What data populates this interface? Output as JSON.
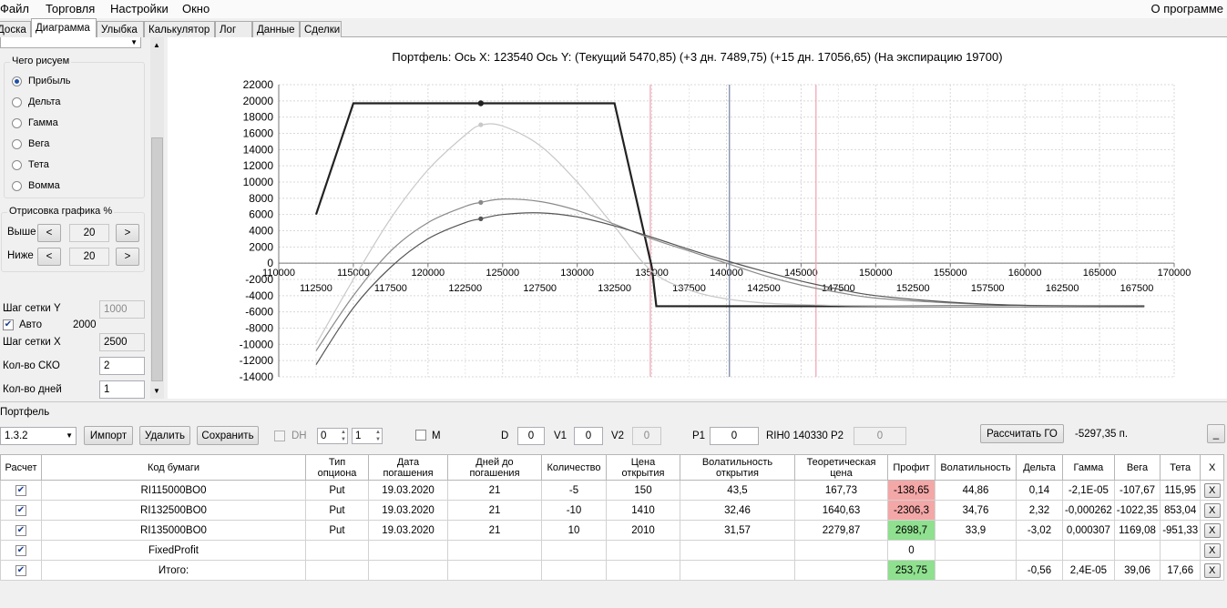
{
  "menu": {
    "file": "Файл",
    "trading": "Торговля",
    "settings": "Настройки",
    "window": "Окно",
    "about": "О программе"
  },
  "tabs": [
    "Доска",
    "Диаграмма",
    "Улыбка",
    "Калькулятор",
    "Лог",
    "Данные",
    "Сделки"
  ],
  "left": {
    "what_draw_title": "Чего рисуем",
    "radios": [
      "Прибыль",
      "Дельта",
      "Гамма",
      "Вега",
      "Тета",
      "Вомма"
    ],
    "draw_pct_title": "Отрисовка графика %",
    "above_label": "Выше",
    "above_value": "20",
    "below_label": "Ниже",
    "below_value": "20",
    "btn_less": "<",
    "btn_more": ">",
    "grid_y_label": "Шаг сетки Y",
    "grid_y_value": "1000",
    "auto_label": "Авто",
    "auto_value": "2000",
    "grid_x_label": "Шаг сетки X",
    "grid_x_value": "2500",
    "sko_label": "Кол-во СКО",
    "sko_value": "2",
    "days_label": "Кол-во дней",
    "days_value": "1"
  },
  "chart_header": "Портфель: Ось X: 123540 Ось Y:  (Текущий 5470,85)  (+3 дн. 7489,75)  (+15 дн. 17056,65)  (На экспирацию 19700)",
  "chart_data": {
    "type": "line",
    "title": "Портфель: Ось X: 123540 Ось Y:  (Текущий 5470,85)  (+3 дн. 7489,75)  (+15 дн. 17056,65)  (На экспирацию 19700)",
    "ylim": [
      -14000,
      22000
    ],
    "xlim": [
      110000,
      170000
    ],
    "y_ticks": [
      "22000",
      "20000",
      "18000",
      "16000",
      "14000",
      "12000",
      "10000",
      "8000",
      "6000",
      "4000",
      "2000",
      "0",
      "-2000",
      "-4000",
      "-6000",
      "-8000",
      "-10000",
      "-12000",
      "-14000"
    ],
    "x_ticks_upper": [
      "110000",
      "115000",
      "120000",
      "125000",
      "130000",
      "135000",
      "140000",
      "145000",
      "150000",
      "155000",
      "160000",
      "165000",
      "170000"
    ],
    "x_ticks_lower": [
      "112500",
      "117500",
      "122500",
      "127500",
      "132500",
      "137500",
      "142500",
      "147500",
      "152500",
      "157500",
      "162500",
      "167500"
    ],
    "grid": true,
    "vertical_lines": [
      {
        "x": 134900,
        "color": "#f0a0b0"
      },
      {
        "x": 140200,
        "color": "#7080a0"
      },
      {
        "x": 146000,
        "color": "#f0a0b0"
      }
    ],
    "series": [
      {
        "color": "#222222",
        "width": 2.2,
        "x": [
          112500,
          115000,
          132500,
          135000,
          135300,
          168000
        ],
        "y": [
          6000,
          19700,
          19700,
          -500,
          -5300,
          -5300
        ],
        "marker": [
          123540,
          19700
        ]
      },
      {
        "color": "#c8c8c8",
        "width": 1.2,
        "x": [
          112500,
          115000,
          117500,
          120000,
          122500,
          123540,
          125000,
          127500,
          130000,
          132500,
          135000,
          137500,
          140000,
          142500,
          145000,
          147500,
          150000,
          155000,
          160000,
          168000
        ],
        "y": [
          -10000,
          -2000,
          5500,
          11500,
          15800,
          17000,
          16900,
          14500,
          10000,
          4500,
          -1000,
          -3300,
          -4400,
          -4900,
          -5100,
          -5200,
          -5250,
          -5300,
          -5300,
          -5300
        ],
        "marker": [
          123540,
          17057
        ]
      },
      {
        "color": "#8a8a8a",
        "width": 1.2,
        "x": [
          112500,
          115000,
          117500,
          120000,
          122500,
          123540,
          125000,
          127500,
          130000,
          132500,
          135000,
          137500,
          140000,
          142500,
          145000,
          147500,
          150000,
          155000,
          160000,
          168000
        ],
        "y": [
          -10800,
          -4000,
          1500,
          5000,
          7000,
          7490,
          7900,
          7600,
          6500,
          4800,
          3000,
          1500,
          0,
          -1500,
          -2700,
          -3600,
          -4300,
          -4900,
          -5200,
          -5300
        ],
        "marker": [
          123540,
          7490
        ]
      },
      {
        "color": "#555555",
        "width": 1.2,
        "x": [
          112500,
          115000,
          117500,
          120000,
          122500,
          123540,
          125000,
          127500,
          130000,
          132500,
          135000,
          137500,
          140000,
          142500,
          145000,
          147500,
          150000,
          155000,
          160000,
          168000
        ],
        "y": [
          -12500,
          -5500,
          -500,
          3000,
          5000,
          5471,
          6000,
          6200,
          5700,
          4600,
          3200,
          1700,
          300,
          -1000,
          -2200,
          -3200,
          -4000,
          -4800,
          -5200,
          -5300
        ],
        "marker": [
          123540,
          5471
        ]
      }
    ]
  },
  "portfolio": {
    "title": "Портфель",
    "combo_value": "1.3.2",
    "btn_import": "Импорт",
    "btn_delete": "Удалить",
    "btn_save": "Сохранить",
    "dh_label": "DH",
    "spin1": "0",
    "spin2": "1",
    "m_label": "M",
    "d_label": "D",
    "d_value": "0",
    "v1_label": "V1",
    "v1_value": "0",
    "v2_label": "V2",
    "v2_value": "0",
    "p1_label": "P1",
    "p1_value": "0",
    "rih_label": "RIH0 140330",
    "p2_label": "P2",
    "p2_value": "0",
    "btn_calc_go": "Рассчитать ГО",
    "go_value": "-5297,35 п.",
    "btn_min": "_"
  },
  "table": {
    "headers": [
      "Расчет",
      "Код бумаги",
      "Тип опциона",
      "Дата погашения",
      "Дней до погашения",
      "Количество",
      "Цена открытия",
      "Волатильность открытия",
      "Теоретическая цена",
      "Профит",
      "Волатильность",
      "Дельта",
      "Гамма",
      "Вега",
      "Тета",
      "X"
    ],
    "rows": [
      {
        "code": "RI115000BO0",
        "type": "Put",
        "date": "19.03.2020",
        "days": "21",
        "qty": "-5",
        "price": "150",
        "vol_open": "43,5",
        "theo": "167,73",
        "profit": "-138,65",
        "profit_state": "neg",
        "vol": "44,86",
        "delta": "0,14",
        "gamma": "-2,1E-05",
        "vega": "-107,67",
        "theta": "115,95",
        "x": "X"
      },
      {
        "code": "RI132500BO0",
        "type": "Put",
        "date": "19.03.2020",
        "days": "21",
        "qty": "-10",
        "price": "1410",
        "vol_open": "32,46",
        "theo": "1640,63",
        "profit": "-2306,3",
        "profit_state": "neg",
        "vol": "34,76",
        "delta": "2,32",
        "gamma": "-0,000262",
        "vega": "-1022,35",
        "theta": "853,04",
        "x": "X"
      },
      {
        "code": "RI135000BO0",
        "type": "Put",
        "date": "19.03.2020",
        "days": "21",
        "qty": "10",
        "price": "2010",
        "vol_open": "31,57",
        "theo": "2279,87",
        "profit": "2698,7",
        "profit_state": "pos",
        "vol": "33,9",
        "delta": "-3,02",
        "gamma": "0,000307",
        "vega": "1169,08",
        "theta": "-951,33",
        "x": "X"
      },
      {
        "code": "FixedProfit",
        "type": "",
        "date": "",
        "days": "",
        "qty": "",
        "price": "",
        "vol_open": "",
        "theo": "",
        "profit": "0",
        "profit_state": "",
        "vol": "",
        "delta": "",
        "gamma": "",
        "vega": "",
        "theta": "",
        "x": "X"
      },
      {
        "code": "Итого:",
        "type": "",
        "date": "",
        "days": "",
        "qty": "",
        "price": "",
        "vol_open": "",
        "theo": "",
        "profit": "253,75",
        "profit_state": "pos",
        "vol": "",
        "delta": "-0,56",
        "gamma": "2,4E-05",
        "vega": "39,06",
        "theta": "17,66",
        "x": "X"
      }
    ]
  }
}
